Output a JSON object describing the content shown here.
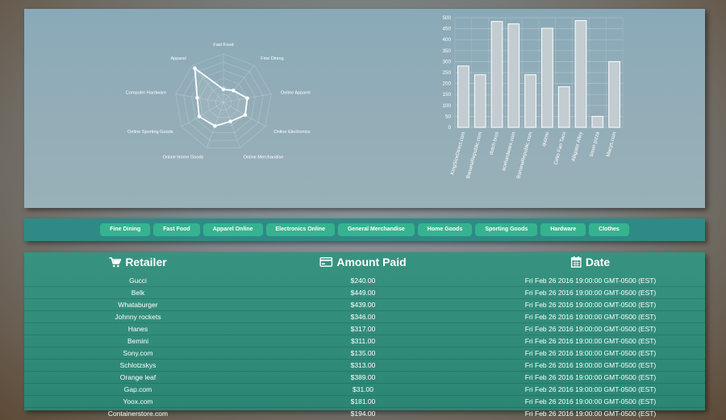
{
  "radar": {
    "type": "radar",
    "axes": [
      "Fast  Food",
      "Fine Dining",
      "Online Apparel",
      "Online Electronics",
      "Online Merchandise",
      "Online Home Goods",
      "Online Sporting Goods",
      "Computer Hardware",
      "Apparel"
    ],
    "values": [
      0.27,
      0.32,
      0.5,
      0.52,
      0.42,
      0.52,
      0.58,
      0.55,
      0.92
    ],
    "colors": {
      "line": "#ffffff",
      "grid": "rgba(255,255,255,0.22)"
    }
  },
  "chart_data": {
    "type": "bar",
    "categories": [
      "KingSizeDirect.com",
      "BananaRepublic.com",
      "dutch bros",
      "acehardware.com",
      "BananaRepublic.com",
      "quizno",
      "Celio Fan Taco",
      "Alligator Alley",
      "bison pizza",
      "Macys.com"
    ],
    "values": [
      280,
      240,
      483,
      472,
      240,
      452,
      185,
      487,
      50,
      300
    ],
    "yticks": [
      0,
      50,
      100,
      150,
      200,
      250,
      300,
      350,
      400,
      450,
      500
    ],
    "ylim": [
      0,
      500
    ],
    "grid": true,
    "colors": {
      "bar_fill": "#c3ccd0",
      "bar_stroke": "#ffffff"
    }
  },
  "filters": [
    "Fine Dining",
    "Fast Food",
    "Apparel Online",
    "Electronics Online",
    "General Merchandise",
    "Home Goods",
    "Sporting Goods",
    "Hardware",
    "Clothes"
  ],
  "table": {
    "headers": {
      "retailer": {
        "icon": "shopping-cart-icon",
        "label": "Retailer"
      },
      "amount": {
        "icon": "credit-card-icon",
        "label": "Amount Paid"
      },
      "date": {
        "icon": "calendar-icon",
        "label": "Date"
      }
    },
    "rows": [
      {
        "retailer": "Gucci",
        "amount": "$240.00",
        "date": "Fri Feb 26 2016 19:00:00 GMT-0500 (EST)"
      },
      {
        "retailer": "Belk",
        "amount": "$449.00",
        "date": "Fri Feb 26 2016 19:00:00 GMT-0500 (EST)"
      },
      {
        "retailer": "Whataburger",
        "amount": "$439.00",
        "date": "Fri Feb 26 2016 19:00:00 GMT-0500 (EST)"
      },
      {
        "retailer": "Johnny rockets",
        "amount": "$346.00",
        "date": "Fri Feb 26 2016 19:00:00 GMT-0500 (EST)"
      },
      {
        "retailer": "Hanes",
        "amount": "$317.00",
        "date": "Fri Feb 26 2016 19:00:00 GMT-0500 (EST)"
      },
      {
        "retailer": "Bemini",
        "amount": "$311.00",
        "date": "Fri Feb 26 2016 19:00:00 GMT-0500 (EST)"
      },
      {
        "retailer": "Sony.com",
        "amount": "$135.00",
        "date": "Fri Feb 26 2016 19:00:00 GMT-0500 (EST)"
      },
      {
        "retailer": "Schlotzskys",
        "amount": "$313.00",
        "date": "Fri Feb 26 2016 19:00:00 GMT-0500 (EST)"
      },
      {
        "retailer": "Orange leaf",
        "amount": "$389.00",
        "date": "Fri Feb 26 2016 19:00:00 GMT-0500 (EST)"
      },
      {
        "retailer": "Gap.com",
        "amount": "$31.00",
        "date": "Fri Feb 26 2016 19:00:00 GMT-0500 (EST)"
      },
      {
        "retailer": "Yoox.com",
        "amount": "$181.00",
        "date": "Fri Feb 26 2016 19:00:00 GMT-0500 (EST)"
      },
      {
        "retailer": "Containerstore.com",
        "amount": "$194.00",
        "date": "Fri Feb 26 2016 19:00:00 GMT-0500 (EST)"
      }
    ]
  }
}
